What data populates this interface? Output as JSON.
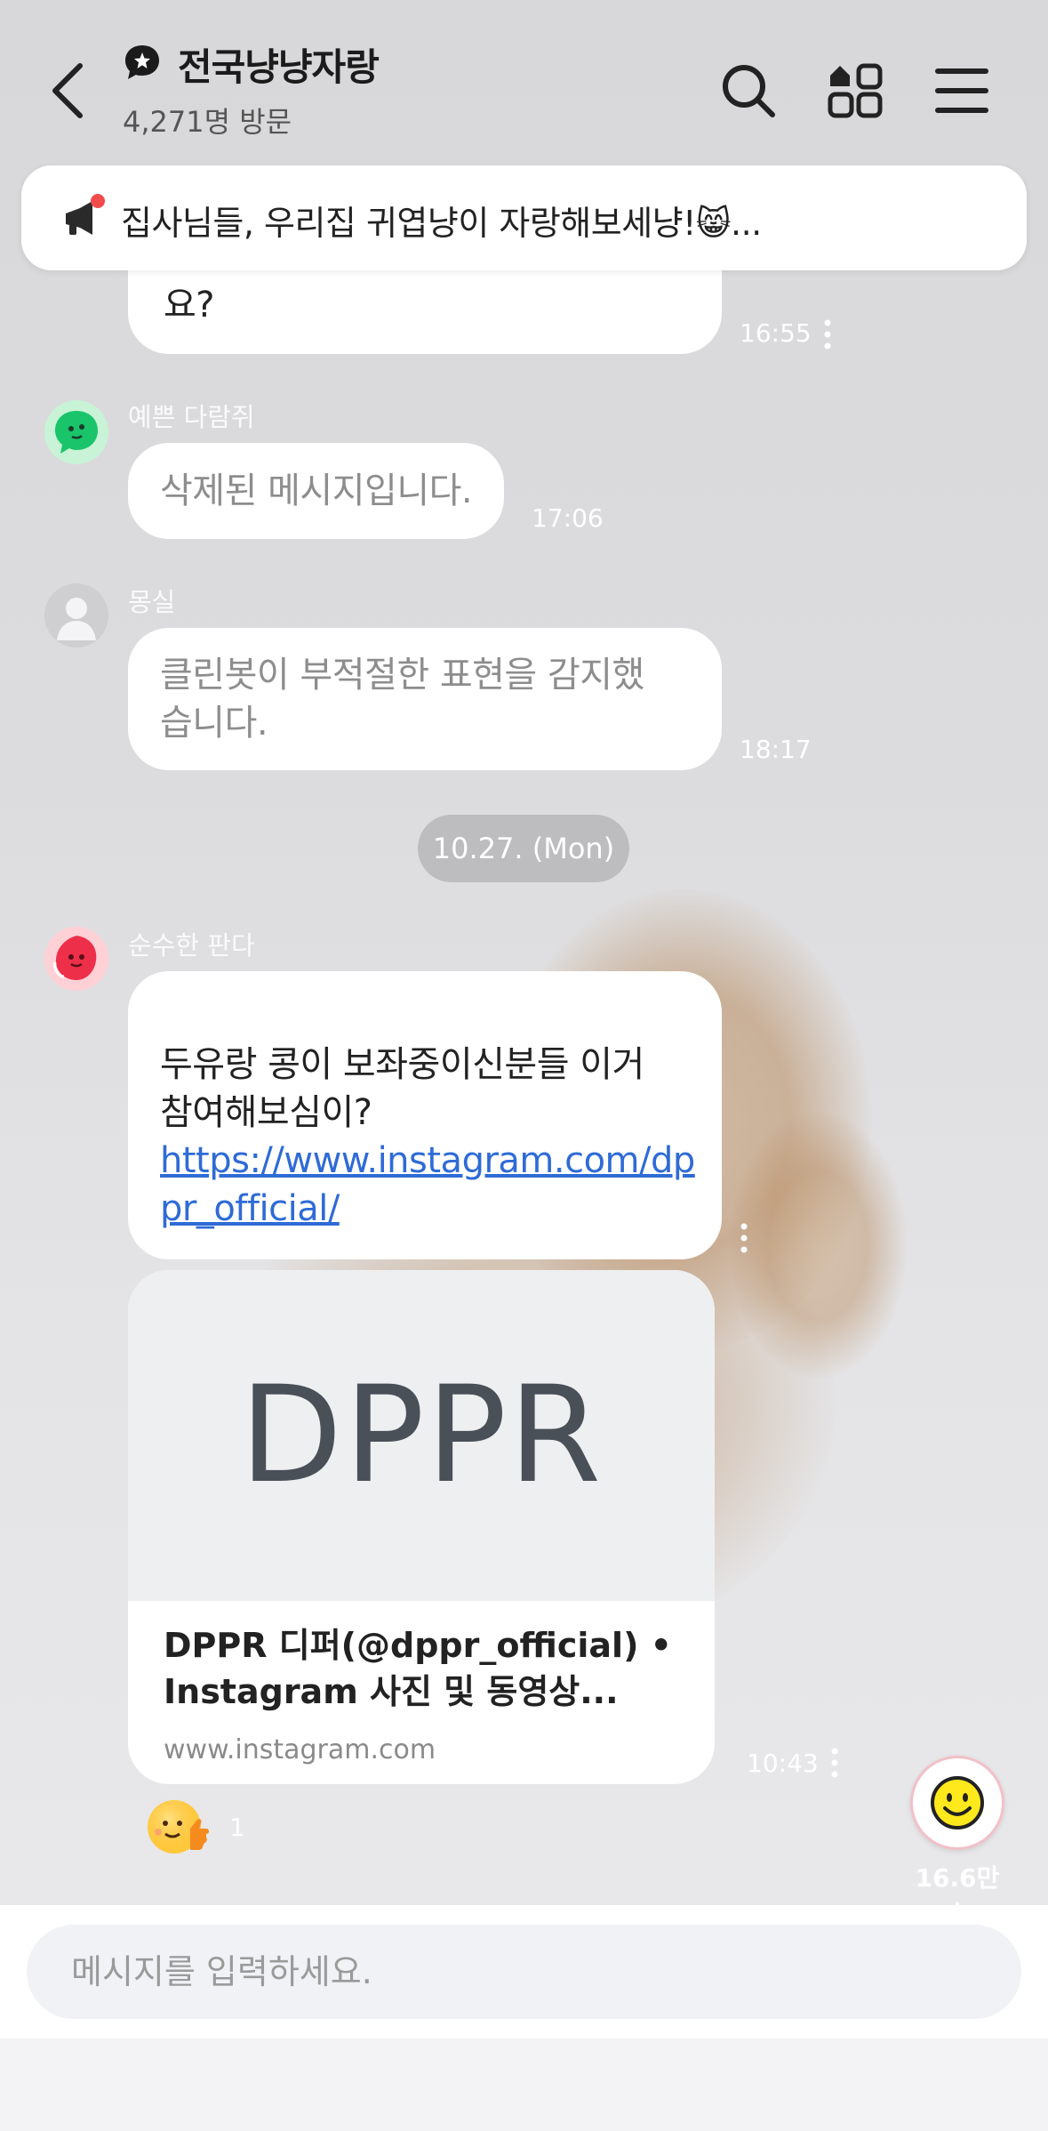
{
  "header": {
    "title": "전국냥냥자랑",
    "visits": "4,271명 방문"
  },
  "notice": {
    "text": "집사님들, 우리집 귀엽냥이 자랑해보세냥!😸..."
  },
  "messages": {
    "m0": {
      "text_tail": "요?",
      "time": "16:55"
    },
    "m1": {
      "sender": "예쁜 다람쥐",
      "text": "삭제된 메시지입니다.",
      "time": "17:06"
    },
    "m2": {
      "sender": "몽실",
      "line1": "클린봇이 부적절한 표현을 감지했",
      "line2": "습니다.",
      "time": "18:17"
    },
    "date_divider": "10.27. (Mon)",
    "m3": {
      "sender": "순수한 판다",
      "line1": "두유랑 콩이 보좌중이신분들 이거",
      "line2": "참여해보심이?",
      "link_line1": "https://www.instagram.com/dp",
      "link_line2": "pr_official/",
      "time": "10:43"
    },
    "link_card": {
      "image_text": "DPPR",
      "title_line1": "DPPR 디퍼(@dppr_official) •",
      "title_line2": "Instagram 사진 및 동영상...",
      "domain": "www.instagram.com"
    },
    "reaction_count": "1"
  },
  "fab": {
    "count": "16.6만+"
  },
  "input": {
    "placeholder": "메시지를 입력하세요."
  },
  "colors": {
    "link": "#2f6bd6",
    "bubble": "#ffffff",
    "date_pill": "#bdbdbf"
  }
}
